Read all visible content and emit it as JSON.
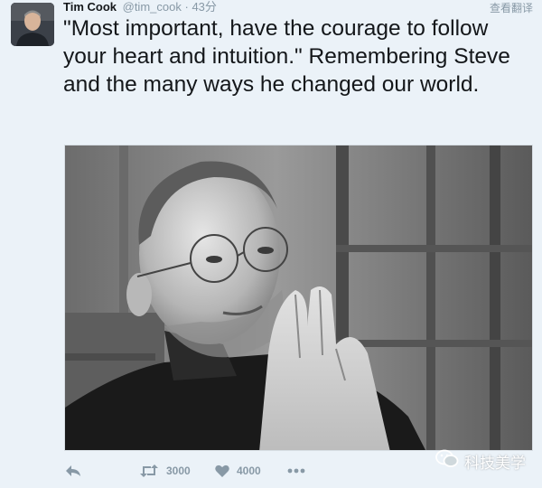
{
  "tweet": {
    "author_name": "Tim Cook",
    "handle": "@tim_cook",
    "separator": "·",
    "time": "43分",
    "translate_label": "查看翻译",
    "text": "\"Most important, have the courage to follow your heart and intuition.\" Remembering Steve and the many ways he changed our world.",
    "media_icon": "photo-of-steve-jobs"
  },
  "actions": {
    "reply_icon": "reply-icon",
    "retweet_icon": "retweet-icon",
    "retweet_count": "3000",
    "like_icon": "heart-icon",
    "like_count": "4000",
    "more_icon": "more-dots-icon"
  },
  "watermark": {
    "text": "科技美学",
    "icon": "wechat-icon"
  },
  "colors": {
    "background": "#ebf2f8",
    "text": "#14171a",
    "muted": "#8899a6"
  }
}
